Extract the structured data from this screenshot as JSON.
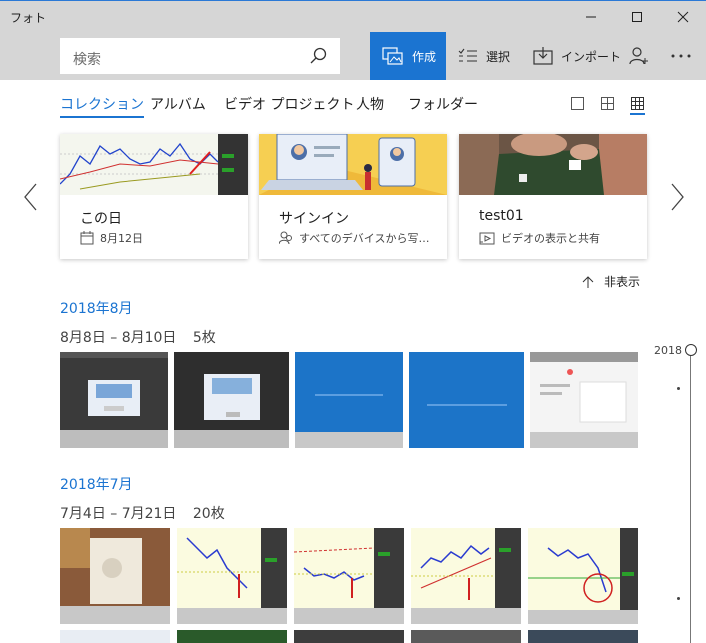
{
  "app": {
    "title": "フォト"
  },
  "search": {
    "placeholder": "検索"
  },
  "toolbar": {
    "create_label": "作成",
    "select_label": "選択",
    "import_label": "インポート"
  },
  "tabs": [
    {
      "label": "コレクション",
      "active": true
    },
    {
      "label": "アルバム"
    },
    {
      "label": "ビデオ プロジェクト"
    },
    {
      "label": "人物"
    },
    {
      "label": "フォルダー"
    }
  ],
  "cards": [
    {
      "title": "この日",
      "subtitle": "8月12日",
      "icon": "calendar-icon"
    },
    {
      "title": "サインイン",
      "subtitle": "すべてのデバイスから写…",
      "icon": "people-icon"
    },
    {
      "title": "test01",
      "subtitle": "ビデオの表示と共有",
      "icon": "video-icon"
    }
  ],
  "hide_label": "非表示",
  "sections": [
    {
      "month": "2018年8月",
      "range": "8月8日 – 8月10日",
      "count": "5枚"
    },
    {
      "month": "2018年7月",
      "range": "7月4日 – 7月21日",
      "count": "20枚"
    }
  ],
  "timeline": {
    "year": "2018"
  },
  "colors": {
    "accent": "#1b74d1",
    "chrome": "#d6d6d6"
  }
}
